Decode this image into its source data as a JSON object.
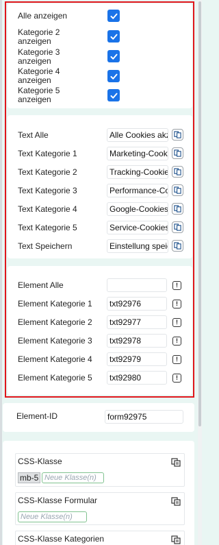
{
  "checkbox_section": {
    "items": [
      {
        "label": "Alle anzeigen",
        "checked": true
      },
      {
        "label": "Kategorie 2 anzeigen",
        "checked": true
      },
      {
        "label": "Kategorie 3 anzeigen",
        "checked": true
      },
      {
        "label": "Kategorie 4 anzeigen",
        "checked": true
      },
      {
        "label": "Kategorie 5 anzeigen",
        "checked": true
      }
    ]
  },
  "text_section": {
    "items": [
      {
        "label": "Text Alle",
        "value": "Alle Cookies akzeptieren"
      },
      {
        "label": "Text Kategorie 1",
        "value": "Marketing-Cookies"
      },
      {
        "label": "Text Kategorie 2",
        "value": "Tracking-Cookies"
      },
      {
        "label": "Text Kategorie 3",
        "value": "Performance-Cookies"
      },
      {
        "label": "Text Kategorie 4",
        "value": "Google-Cookies"
      },
      {
        "label": "Text Kategorie 5",
        "value": "Service-Cookies"
      },
      {
        "label": "Text Speichern",
        "value": "Einstellung speichern"
      }
    ]
  },
  "element_section": {
    "items": [
      {
        "label": "Element Alle",
        "value": ""
      },
      {
        "label": "Element Kategorie 1",
        "value": "txt92976"
      },
      {
        "label": "Element Kategorie 2",
        "value": "txt92977"
      },
      {
        "label": "Element Kategorie 3",
        "value": "txt92978"
      },
      {
        "label": "Element Kategorie 4",
        "value": "txt92979"
      },
      {
        "label": "Element Kategorie 5",
        "value": "txt92980"
      }
    ]
  },
  "element_id": {
    "label": "Element-ID",
    "value": "form92975"
  },
  "css_section": {
    "groups": [
      {
        "title": "CSS-Klasse",
        "tags": [
          "mb-5"
        ],
        "new_placeholder": "Neue Klasse(n)"
      },
      {
        "title": "CSS-Klasse Formular",
        "tags": [],
        "new_placeholder": "Neue Klasse(n)"
      },
      {
        "title": "CSS-Klasse Kategorien",
        "tags": [],
        "new_placeholder": ""
      }
    ]
  },
  "colors": {
    "highlight_border": "#e0151b",
    "checkbox": "#1a73e8",
    "background": "#e9f6f3"
  }
}
